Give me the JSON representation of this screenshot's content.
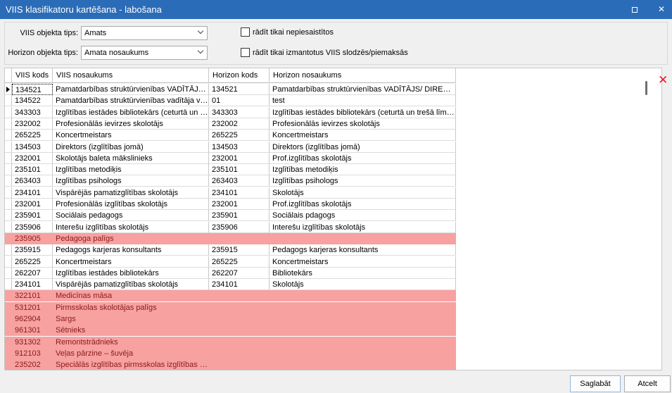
{
  "window": {
    "title": "VIIS klasifikatoru kartēšana - labošana"
  },
  "filters": {
    "viis_type_label": "VIIS objekta tips:",
    "viis_type_value": "Amats",
    "horizon_type_label": "Horizon objekta tips:",
    "horizon_type_value": "Amata nosaukums",
    "checkbox1_label": "rādīt tikai nepiesaistītos",
    "checkbox1_checked": false,
    "checkbox2_label": "rādīt tikai izmantotus VIIS slodzēs/piemaksās",
    "checkbox2_checked": false
  },
  "table": {
    "columns": [
      "VIIS kods",
      "VIIS nosaukums",
      "Horizon kods",
      "Horizon nosaukums"
    ],
    "rows": [
      {
        "c1": "134521",
        "c2": "Pamatdarbības struktūrvienības VADĪTĀJS/ DI...",
        "c3": "134521",
        "c4": "Pamatdarbības struktūrvienības VADĪTĀJS/ DIREKTORS...",
        "unmapped": false
      },
      {
        "c1": "134522",
        "c2": "Pamatdarbības struktūrvienības vadītāja vietni...",
        "c3": "01",
        "c4": "test",
        "unmapped": false
      },
      {
        "c1": "343303",
        "c2": "Izglītības iestādes bibliotekārs (ceturtā un trešā ...",
        "c3": "343303",
        "c4": "Izglītības iestādes bibliotekārs (ceturtā un trešā līmeņa kv...",
        "unmapped": false
      },
      {
        "c1": "232002",
        "c2": "Profesionālās ievirzes skolotājs",
        "c3": "232002",
        "c4": "Profesionālās ievirzes skolotājs",
        "unmapped": false
      },
      {
        "c1": "265225",
        "c2": "Koncertmeistars",
        "c3": "265225",
        "c4": "Koncertmeistars",
        "unmapped": false
      },
      {
        "c1": "134503",
        "c2": "Direktors (izglītības jomā)",
        "c3": "134503",
        "c4": "Direktors (izglītības jomā)",
        "unmapped": false
      },
      {
        "c1": "232001",
        "c2": "Skolotājs baleta mākslinieks",
        "c3": "232001",
        "c4": "Prof.izglītības skolotājs",
        "unmapped": false
      },
      {
        "c1": "235101",
        "c2": "Izglītības metodiķis",
        "c3": "235101",
        "c4": "Izglītības metodiķis",
        "unmapped": false
      },
      {
        "c1": "263403",
        "c2": "Izglītības psihologs",
        "c3": "263403",
        "c4": "Izglītības psihologs",
        "unmapped": false
      },
      {
        "c1": "234101",
        "c2": "Vispārējās pamatizglītības skolotājs",
        "c3": "234101",
        "c4": "Skolotājs",
        "unmapped": false
      },
      {
        "c1": "232001",
        "c2": "Profesionālās izglītības skolotājs",
        "c3": "232001",
        "c4": "Prof.izglītības skolotājs",
        "unmapped": false
      },
      {
        "c1": "235901",
        "c2": "Sociālais pedagogs",
        "c3": "235901",
        "c4": "Sociālais pdagogs",
        "unmapped": false
      },
      {
        "c1": "235906",
        "c2": "Interešu izglītības skolotājs",
        "c3": "235906",
        "c4": "Interešu izglītības skolotājs",
        "unmapped": false
      },
      {
        "c1": "235905",
        "c2": "Pedagoga palīgs",
        "c3": "",
        "c4": "",
        "unmapped": true
      },
      {
        "c1": "235915",
        "c2": "Pedagogs karjeras konsultants",
        "c3": "235915",
        "c4": "Pedagogs karjeras konsultants",
        "unmapped": false
      },
      {
        "c1": "265225",
        "c2": "Koncertmeistars",
        "c3": "265225",
        "c4": "Koncertmeistars",
        "unmapped": false
      },
      {
        "c1": "262207",
        "c2": "Izglītības iestādes bibliotekārs",
        "c3": "262207",
        "c4": "Bibliotekārs",
        "unmapped": false
      },
      {
        "c1": "234101",
        "c2": "Vispārējās pamatizglītības skolotājs",
        "c3": "234101",
        "c4": "Skolotājs",
        "unmapped": false
      },
      {
        "c1": "322101",
        "c2": "Medicīnas māsa",
        "c3": "",
        "c4": "",
        "unmapped": true
      },
      {
        "c1": "531201",
        "c2": "Pirmsskolas skolotājas palīgs",
        "c3": "",
        "c4": "",
        "unmapped": true
      },
      {
        "c1": "962904",
        "c2": "Sargs",
        "c3": "",
        "c4": "",
        "unmapped": true
      },
      {
        "c1": "961301",
        "c2": "Sētnieks",
        "c3": "",
        "c4": "",
        "unmapped": true
      },
      {
        "c1": "931302",
        "c2": "Remontstrādnieks",
        "c3": "",
        "c4": "",
        "unmapped": true
      },
      {
        "c1": "912103",
        "c2": "Veļas pārzine – šuvēja",
        "c3": "",
        "c4": "",
        "unmapped": true
      },
      {
        "c1": "235202",
        "c2": "Speciālās izglītības pirmsskolas izglītības skolotājs",
        "c3": "",
        "c4": "",
        "unmapped": true
      }
    ]
  },
  "buttons": {
    "save": "Saglabāt",
    "cancel": "Atcelt"
  },
  "colors": {
    "titlebar": "#2b6cb8",
    "unmapped_row": "#f7a1a1",
    "delete_icon": "#e3202a"
  },
  "icons": {
    "delete": "close-x-icon"
  }
}
